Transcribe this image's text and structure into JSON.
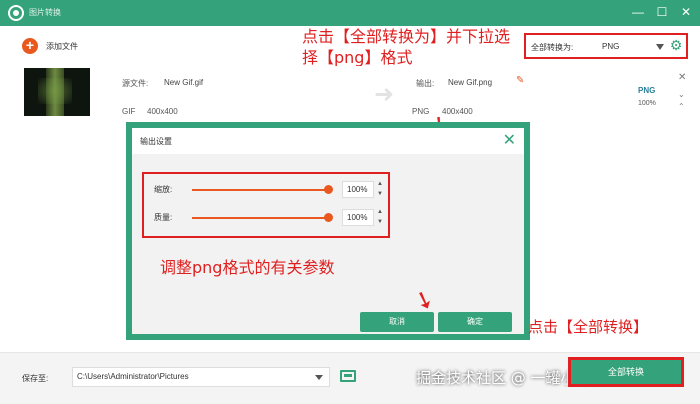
{
  "window": {
    "title": "图片转换",
    "minimize": "—",
    "maximize": "☐",
    "close": "✕"
  },
  "toolbar": {
    "add_file_label": "添加文件",
    "convert_all_label": "全部转换为:",
    "convert_all_value": "PNG"
  },
  "file": {
    "source_label": "源文件:",
    "source_name": "New Gif.gif",
    "source_format": "GIF",
    "source_size": "400x400",
    "output_label": "输出:",
    "output_name": "New Gif.png",
    "output_format": "PNG",
    "output_size": "400x400",
    "badge": "PNG",
    "percent": "100%"
  },
  "dialog": {
    "title": "输出设置",
    "scale_label": "缩放:",
    "scale_value": "100%",
    "quality_label": "质量:",
    "quality_value": "100%",
    "scale_level": 1.0,
    "quality_level": 1.0,
    "cancel_label": "取消",
    "ok_label": "确定"
  },
  "annotations": {
    "top": "点击【全部转换为】并下拉选择【png】格式",
    "dialog": "调整png格式的有关参数",
    "right": "点击【全部转换】"
  },
  "bottom": {
    "save_label": "保存至:",
    "save_path": "C:\\Users\\Administrator\\Pictures",
    "watermark": "掘金技术社区 @ 一罐小可乐",
    "convert_all_button": "全部转换"
  },
  "colors": {
    "brand": "#34a27a",
    "accent": "#e8581f",
    "annotation": "#e02020"
  }
}
